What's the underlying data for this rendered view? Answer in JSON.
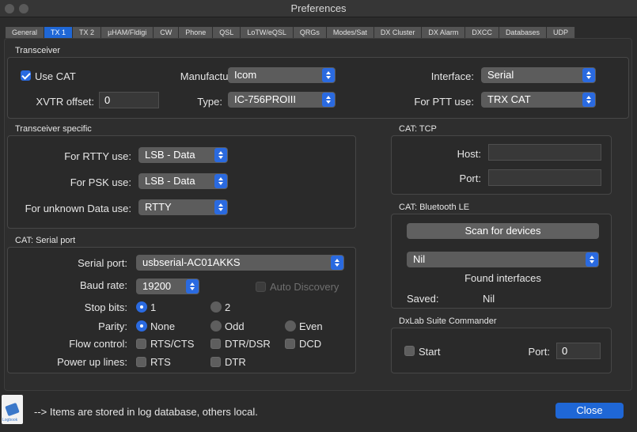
{
  "window": {
    "title": "Preferences"
  },
  "tabs": [
    "General",
    "TX 1",
    "TX 2",
    "µHAM/Fldigi",
    "CW",
    "Phone",
    "QSL",
    "LoTW/eQSL",
    "QRGs",
    "Modes/Sat",
    "DX Cluster",
    "DX Alarm",
    "DXCC",
    "Databases",
    "UDP"
  ],
  "active_tab": "TX 1",
  "transceiver": {
    "title": "Transceiver",
    "use_cat_label": "Use CAT",
    "use_cat_checked": true,
    "manufacturer_label": "Manufacturer:",
    "manufacturer_value": "Icom",
    "interface_label": "Interface:",
    "interface_value": "Serial",
    "xvtr_label": "XVTR offset:",
    "xvtr_value": "0",
    "type_label": "Type:",
    "type_value": "IC-756PROIII",
    "ptt_label": "For PTT use:",
    "ptt_value": "TRX CAT"
  },
  "specific": {
    "title": "Transceiver specific",
    "rtty_label": "For RTTY use:",
    "rtty_value": "LSB - Data",
    "psk_label": "For PSK use:",
    "psk_value": "LSB - Data",
    "unknown_label": "For unknown Data use:",
    "unknown_value": "RTTY"
  },
  "serial": {
    "title": "CAT: Serial port",
    "port_label": "Serial port:",
    "port_value": "usbserial-AC01AKKS",
    "baud_label": "Baud rate:",
    "baud_value": "19200",
    "auto_discovery_label": "Auto Discovery",
    "stop_bits_label": "Stop bits:",
    "stop_bits_1": "1",
    "stop_bits_2": "2",
    "parity_label": "Parity:",
    "parity_none": "None",
    "parity_odd": "Odd",
    "parity_even": "Even",
    "flow_label": "Flow control:",
    "flow_rts_cts": "RTS/CTS",
    "flow_dtr_dsr": "DTR/DSR",
    "flow_dcd": "DCD",
    "power_label": "Power up lines:",
    "power_rts": "RTS",
    "power_dtr": "DTR"
  },
  "tcp": {
    "title": "CAT: TCP",
    "host_label": "Host:",
    "host_value": "",
    "port_label": "Port:",
    "port_value": ""
  },
  "bluetooth": {
    "title": "CAT: Bluetooth LE",
    "scan_label": "Scan for devices",
    "device_value": "Nil",
    "found_label": "Found interfaces",
    "saved_label": "Saved:",
    "saved_value": "Nil"
  },
  "dxlab": {
    "title": "DxLab Suite Commander",
    "start_label": "Start",
    "port_label": "Port:",
    "port_value": "0"
  },
  "footer": {
    "note": "--> Items are stored in log database, others local.",
    "close_label": "Close",
    "logbook_label": "Logbook"
  }
}
